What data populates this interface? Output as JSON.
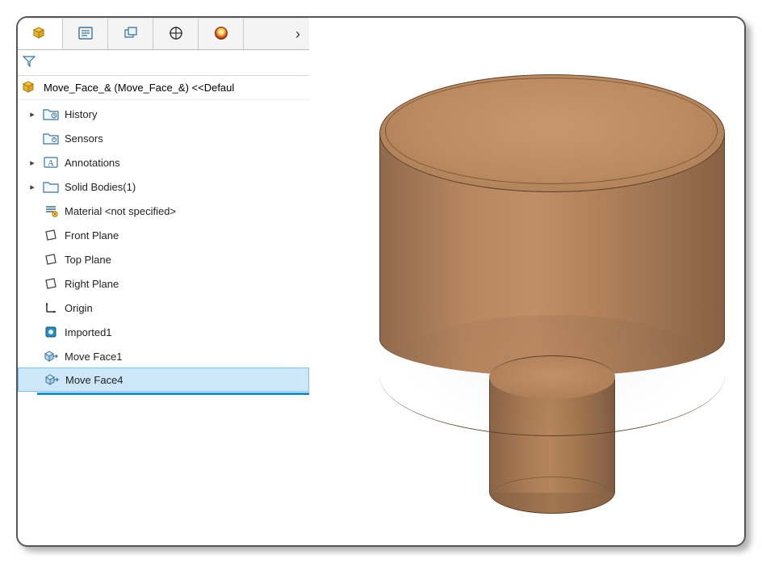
{
  "tabs": {
    "items": [
      {
        "name": "feature-manager-tab",
        "active": true
      },
      {
        "name": "property-manager-tab",
        "active": false
      },
      {
        "name": "configuration-manager-tab",
        "active": false
      },
      {
        "name": "dimxpert-manager-tab",
        "active": false
      },
      {
        "name": "display-manager-tab",
        "active": false
      }
    ],
    "overflow_glyph": "›"
  },
  "filter": {
    "placeholder": ""
  },
  "root": {
    "label": "Move_Face_& (Move_Face_&) <<Defaul"
  },
  "tree": {
    "items": [
      {
        "label": "History",
        "icon": "folder-history-icon",
        "expandable": true,
        "selected": false,
        "name": "tree-item-history"
      },
      {
        "label": "Sensors",
        "icon": "sensors-icon",
        "expandable": false,
        "selected": false,
        "name": "tree-item-sensors"
      },
      {
        "label": "Annotations",
        "icon": "annotations-icon",
        "expandable": true,
        "selected": false,
        "name": "tree-item-annotations"
      },
      {
        "label": "Solid Bodies(1)",
        "icon": "solid-bodies-icon",
        "expandable": true,
        "selected": false,
        "name": "tree-item-solid-bodies"
      },
      {
        "label": "Material <not specified>",
        "icon": "material-icon",
        "expandable": false,
        "selected": false,
        "name": "tree-item-material"
      },
      {
        "label": "Front Plane",
        "icon": "plane-icon",
        "expandable": false,
        "selected": false,
        "name": "tree-item-front-plane"
      },
      {
        "label": "Top Plane",
        "icon": "plane-icon",
        "expandable": false,
        "selected": false,
        "name": "tree-item-top-plane"
      },
      {
        "label": "Right Plane",
        "icon": "plane-icon",
        "expandable": false,
        "selected": false,
        "name": "tree-item-right-plane"
      },
      {
        "label": "Origin",
        "icon": "origin-icon",
        "expandable": false,
        "selected": false,
        "name": "tree-item-origin"
      },
      {
        "label": "Imported1",
        "icon": "imported-feature-icon",
        "expandable": false,
        "selected": false,
        "name": "tree-item-imported1"
      },
      {
        "label": "Move Face1",
        "icon": "move-face-icon",
        "expandable": false,
        "selected": false,
        "name": "tree-item-move-face1"
      },
      {
        "label": "Move Face4",
        "icon": "move-face-icon",
        "expandable": false,
        "selected": true,
        "name": "tree-item-move-face4"
      }
    ]
  },
  "colors": {
    "selected_bg": "#cde7f9",
    "rollback_bar": "#1e90cc",
    "material_base": "#b3825c"
  }
}
